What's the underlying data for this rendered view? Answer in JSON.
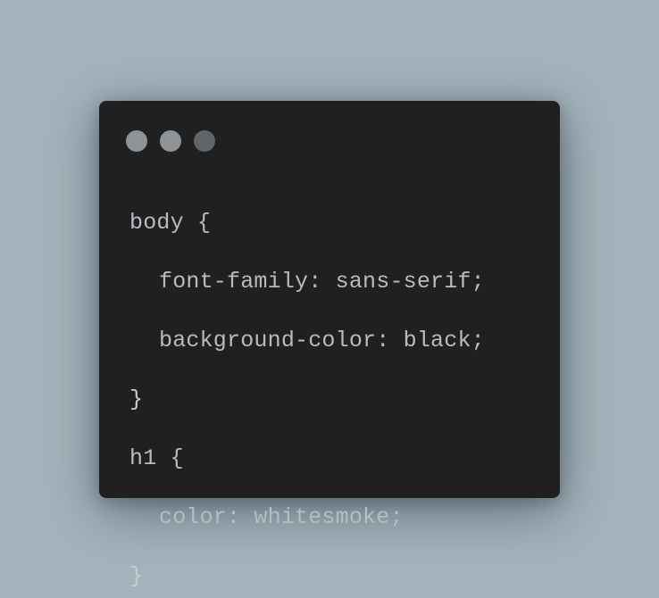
{
  "window": {
    "controls": [
      {
        "name": "close",
        "color": "#8f9499"
      },
      {
        "name": "minimize",
        "color": "#8f9499"
      },
      {
        "name": "maximize",
        "color": "#5e6468"
      }
    ]
  },
  "code": {
    "language": "css",
    "lines": [
      {
        "indent": 0,
        "text": "body {"
      },
      {
        "indent": 1,
        "text": "font-family: sans-serif;"
      },
      {
        "indent": 1,
        "text": "background-color: black;"
      },
      {
        "indent": 0,
        "text": "}"
      },
      {
        "indent": 0,
        "text": "h1 {"
      },
      {
        "indent": 1,
        "text": "color: whitesmoke;"
      },
      {
        "indent": 0,
        "text": "}"
      }
    ]
  }
}
